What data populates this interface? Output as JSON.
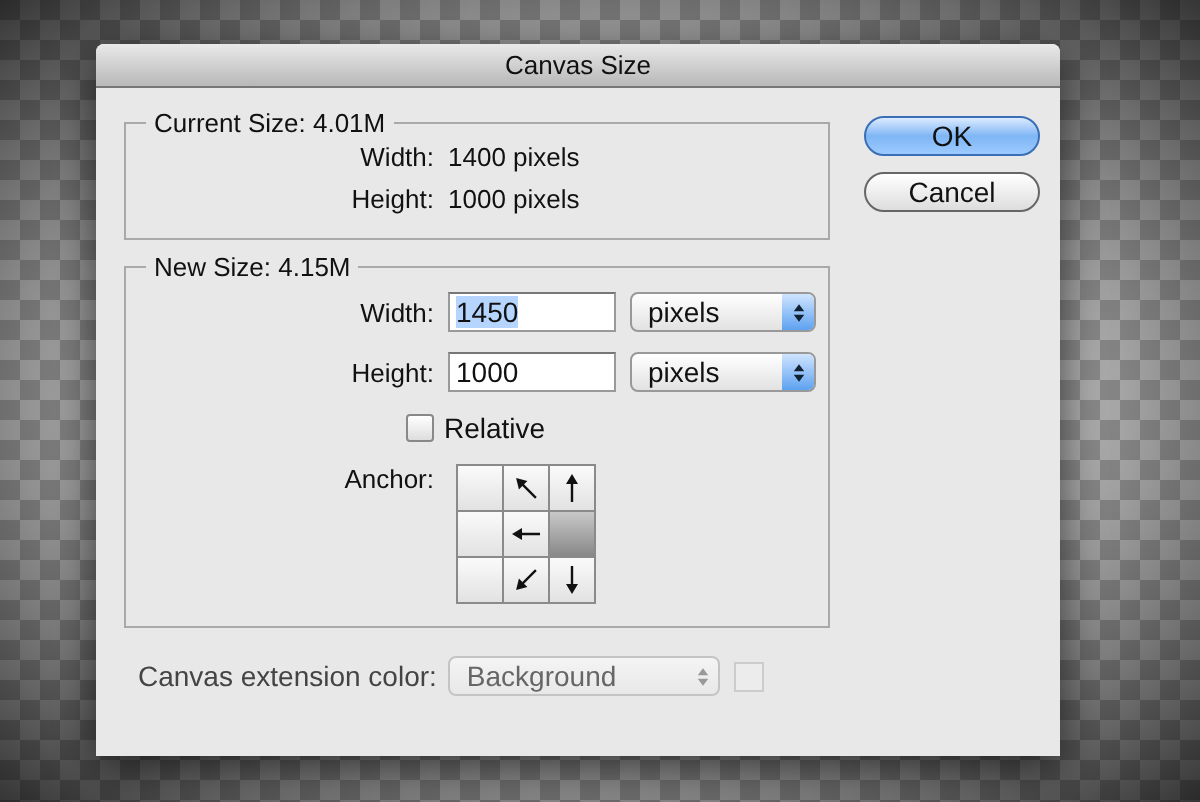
{
  "window": {
    "title": "Canvas Size"
  },
  "current_size": {
    "title": "Current Size: 4.01M",
    "rows": [
      {
        "label": "Width:",
        "value": "1400 pixels"
      },
      {
        "label": "Height:",
        "value": "1000 pixels"
      }
    ]
  },
  "new_size": {
    "title": "New Size: 4.15M",
    "fields": [
      {
        "label": "Width:",
        "value": "1450",
        "text_selected": true,
        "unit": "pixels"
      },
      {
        "label": "Height:",
        "value": "1000",
        "text_selected": false,
        "unit": "pixels"
      }
    ],
    "relative": {
      "label": "Relative",
      "checked": false
    },
    "anchor": {
      "label": "Anchor:",
      "cells": [
        {
          "selected": false
        },
        {
          "selected": false
        },
        {
          "selected": false
        },
        {
          "selected": false
        },
        {
          "selected": false
        },
        {
          "selected": true
        },
        {
          "selected": false
        },
        {
          "selected": false
        },
        {
          "selected": false
        }
      ]
    }
  },
  "extension": {
    "label": "Canvas extension color:",
    "value": "Background",
    "disabled": true
  },
  "buttons": [
    {
      "label": "OK",
      "default": true
    },
    {
      "label": "Cancel",
      "default": false
    }
  ]
}
